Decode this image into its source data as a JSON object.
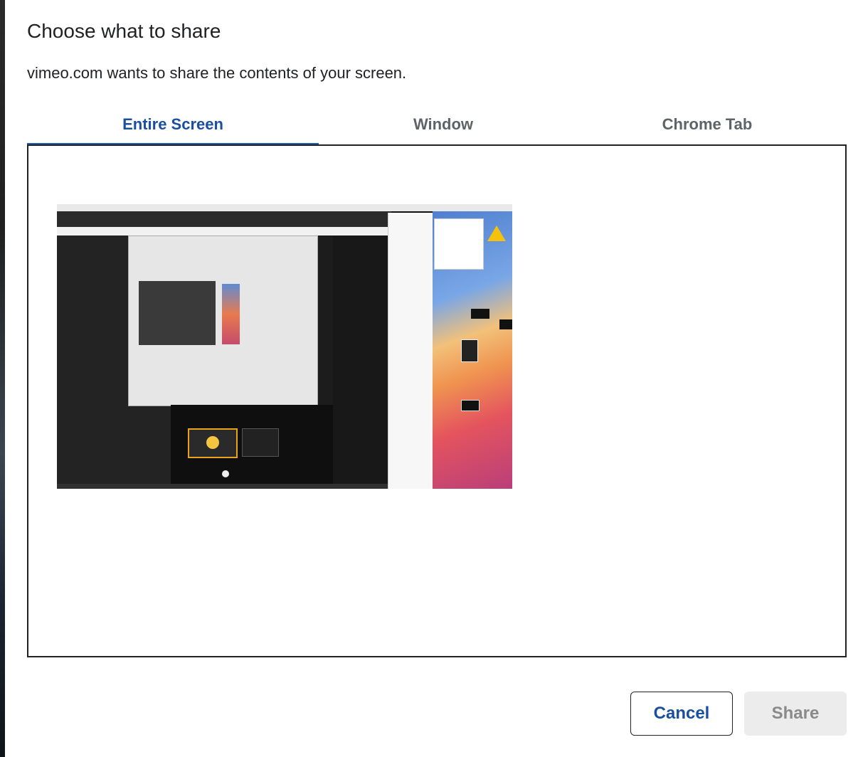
{
  "dialog": {
    "title": "Choose what to share",
    "subtitle": "vimeo.com wants to share the contents of your screen."
  },
  "tabs": [
    {
      "label": "Entire Screen",
      "active": true
    },
    {
      "label": "Window",
      "active": false
    },
    {
      "label": "Chrome Tab",
      "active": false
    }
  ],
  "preview": {
    "selected": false
  },
  "buttons": {
    "cancel_label": "Cancel",
    "share_label": "Share",
    "share_enabled": false
  },
  "colors": {
    "accent": "#1a4fa0",
    "text": "#202124",
    "muted": "#5f6368",
    "disabled_bg": "#ececec"
  }
}
